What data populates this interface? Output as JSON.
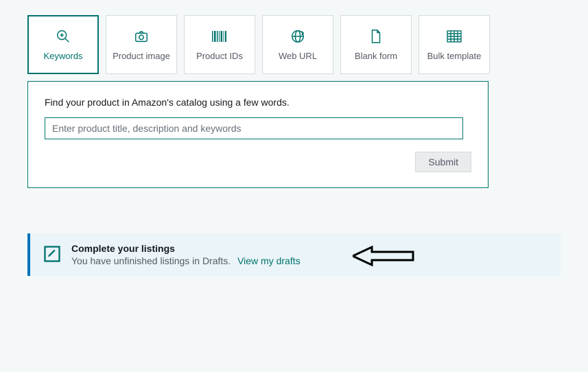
{
  "tabs": [
    {
      "label": "Keywords"
    },
    {
      "label": "Product image"
    },
    {
      "label": "Product IDs"
    },
    {
      "label": "Web URL"
    },
    {
      "label": "Blank form"
    },
    {
      "label": "Bulk template"
    }
  ],
  "panel": {
    "prompt": "Find your product in Amazon's catalog using a few words.",
    "placeholder": "Enter product title, description and keywords",
    "submit": "Submit"
  },
  "alert": {
    "title": "Complete your listings",
    "message": "You have unfinished listings in Drafts.",
    "link": "View my drafts"
  }
}
